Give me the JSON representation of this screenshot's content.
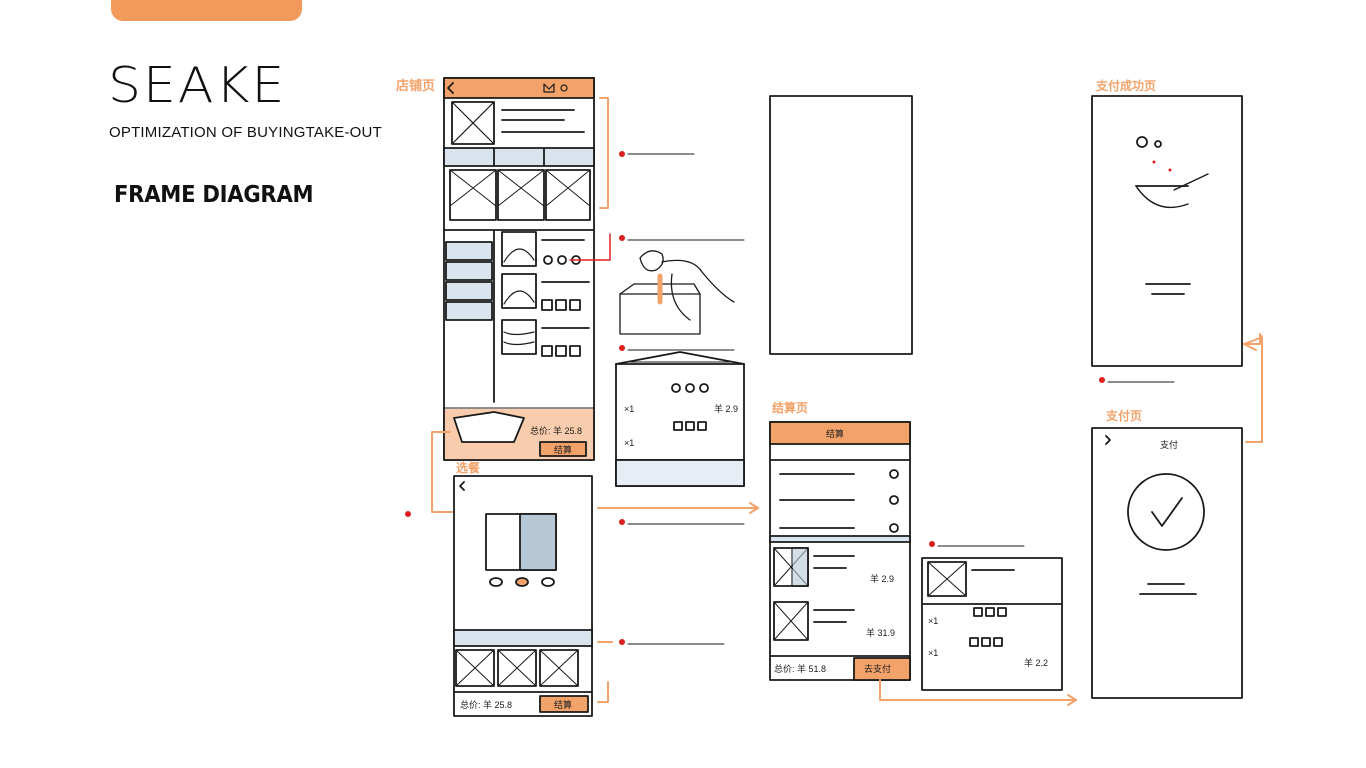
{
  "header": {
    "brand": "SEAKE",
    "subtitle": "OPTIMIZATION OF BUYINGTAKE-OUT",
    "section_title": "FRAME DIAGRAM"
  },
  "sketch": {
    "subject": "hand-drawn take-out ordering app wireframes with orange annotations",
    "screens": [
      {
        "price_total": "总价: 羊 25.8",
        "button": "结算"
      },
      {
        "price_total": "总价: 羊 25.8",
        "button": "结算"
      },
      {
        "title": "结算",
        "total": "总价: 羊 51.8",
        "button": "去支付"
      },
      {
        "title": "支付"
      }
    ],
    "item_lines": [
      "×1",
      "羊 2.9",
      "×1",
      "羊 31.9",
      "羊 2.2"
    ]
  },
  "colors": {
    "accent": "#f19a5b",
    "ink": "#1a1a1a",
    "annotation_dot": "#e02020"
  }
}
